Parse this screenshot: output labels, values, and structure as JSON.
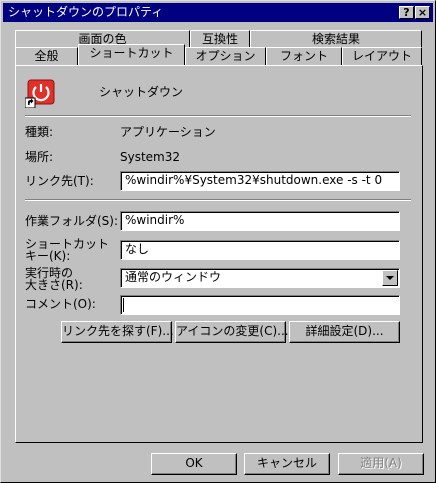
{
  "window": {
    "title": "シャットダウンのプロパティ"
  },
  "titlebar_buttons": {
    "help": "?",
    "close": "×"
  },
  "tabs_back": [
    "画面の色",
    "互換性",
    "検索結果"
  ],
  "tabs_front": [
    "全般",
    "ショートカット",
    "オプション",
    "フォント",
    "レイアウト"
  ],
  "shortcut": {
    "name": "シャットダウン",
    "type_label": "種類:",
    "type_value": "アプリケーション",
    "location_label": "場所:",
    "location_value": "System32",
    "target_label": "リンク先(T):",
    "target_value": "%windir%¥System32¥shutdown.exe -s -t 0",
    "workdir_label": "作業フォルダ(S):",
    "workdir_value": "%windir%",
    "hotkey_label_line1": "ショートカット",
    "hotkey_label_line2": "キー(K):",
    "hotkey_value": "なし",
    "run_label_line1": "実行時の",
    "run_label_line2": "大きさ(R):",
    "run_value": "通常のウィンドウ",
    "comment_label": "コメント(O):",
    "comment_value": ""
  },
  "panel_buttons": {
    "find_target": "リンク先を探す(F)...",
    "change_icon": "アイコンの変更(C)...",
    "advanced": "詳細設定(D)..."
  },
  "dialog_buttons": {
    "ok": "OK",
    "cancel": "キャンセル",
    "apply": "適用(A)"
  },
  "colors": {
    "title_bg": "#000080",
    "face": "#c0c0c0",
    "icon_red": "#e0302a"
  },
  "icons": {
    "shortcut_icon": "power-icon",
    "dropdown": "chevron-down-icon"
  }
}
